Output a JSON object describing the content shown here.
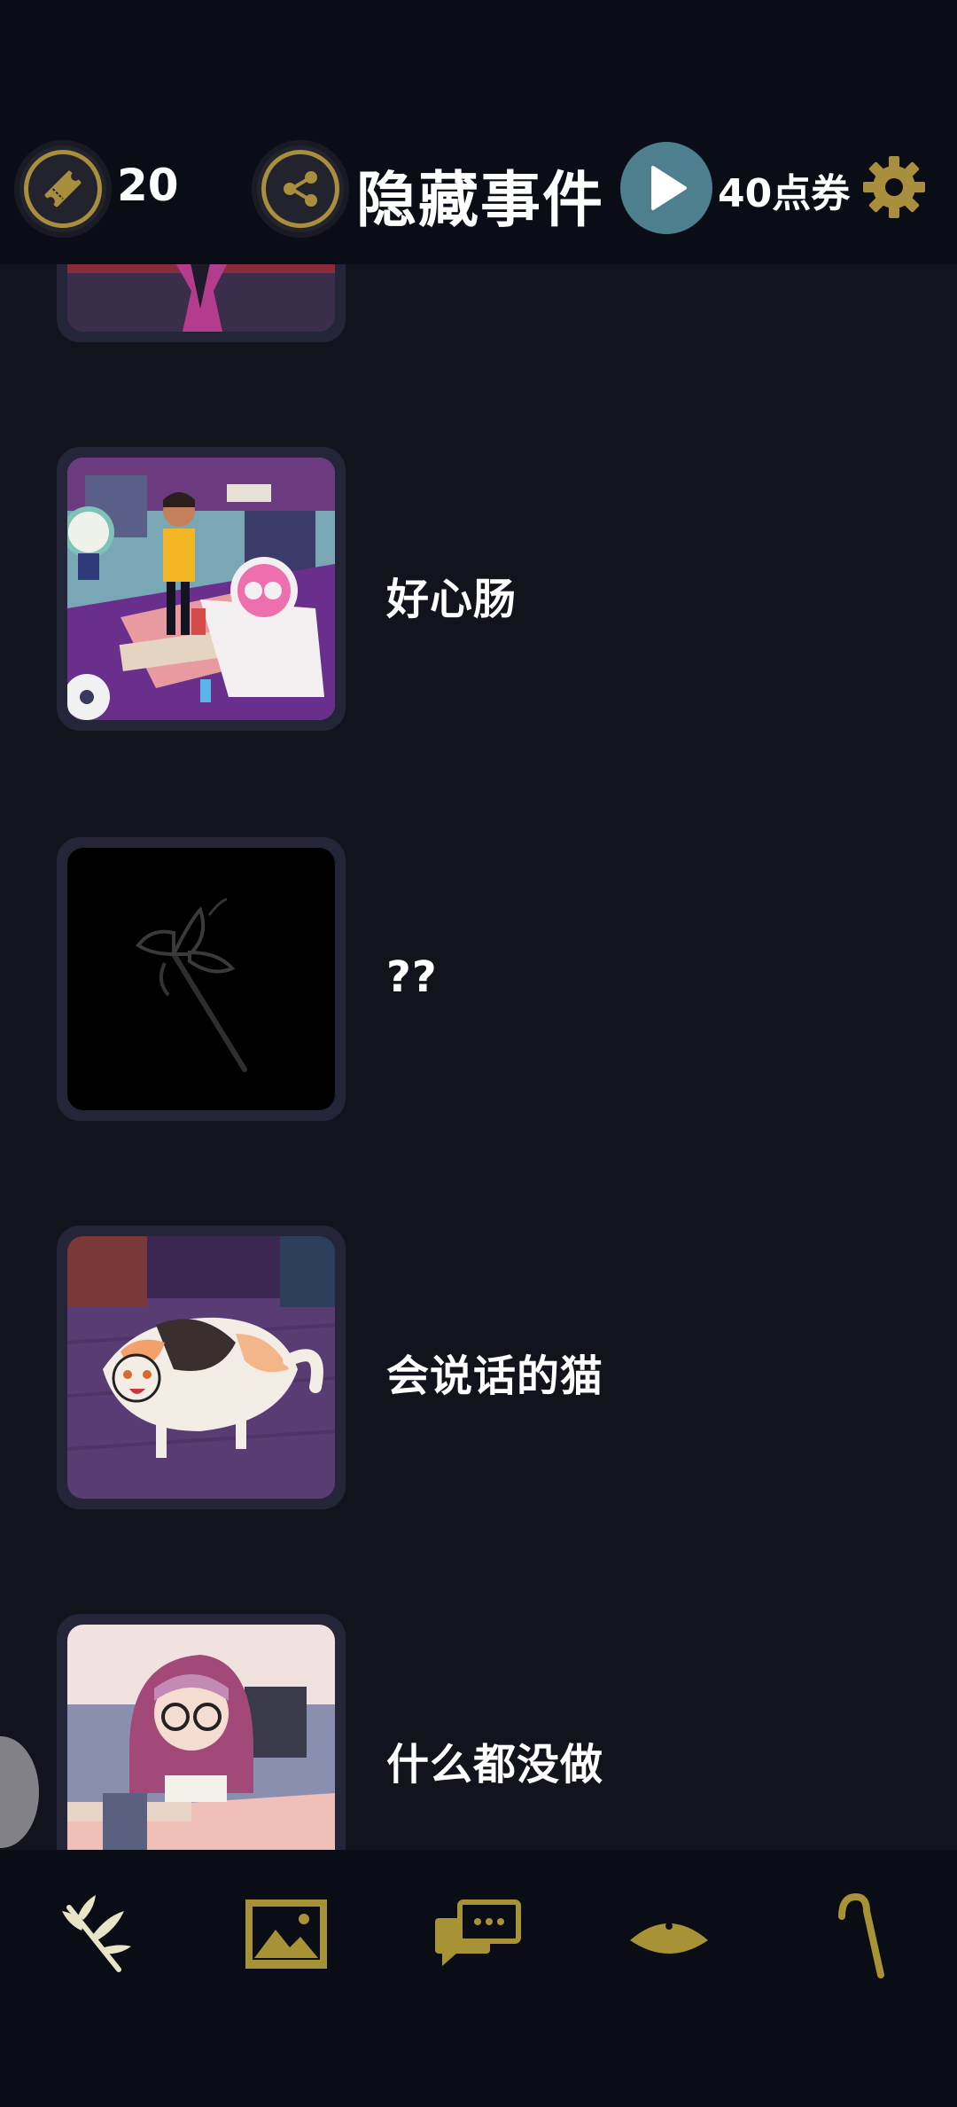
{
  "header": {
    "ticket_count": "20",
    "title": "隐藏事件",
    "points_label": "40点券"
  },
  "events": [
    {
      "label": "",
      "locked": false
    },
    {
      "label": "好心肠",
      "locked": false
    },
    {
      "label": "??",
      "locked": true
    },
    {
      "label": "会说话的猫",
      "locked": false
    },
    {
      "label": "什么都没做",
      "locked": false
    }
  ],
  "bottom_nav": [
    {
      "icon": "flower-branch-icon"
    },
    {
      "icon": "gallery-image-icon"
    },
    {
      "icon": "chat-bubbles-icon"
    },
    {
      "icon": "hat-icon"
    },
    {
      "icon": "cane-icon"
    }
  ],
  "colors": {
    "accent_gold": "#a88e3d",
    "background": "#12131c",
    "bar_background": "#0a0d16",
    "play_button": "#4d7f8f"
  }
}
